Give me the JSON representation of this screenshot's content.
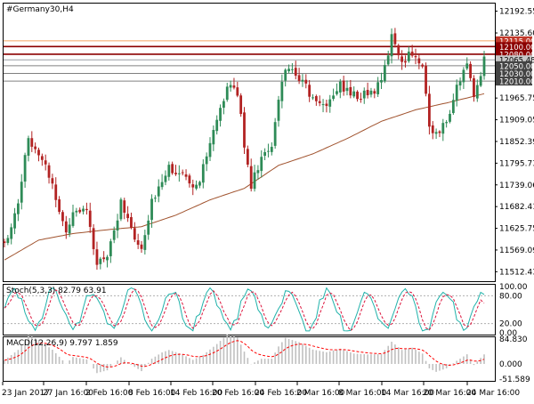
{
  "window_title": "#Germany30,H4",
  "colors": {
    "bull": "#2e8b57",
    "bear": "#b22222",
    "ma": "#a0522d",
    "stoch_main": "#20b2aa",
    "stoch_signal": "#dc143c",
    "macd_hist": "#c0c0c0",
    "macd_signal": "#ff0000",
    "gray_level": "#808080",
    "red_level": "#8b0000",
    "orange_level": "#f4a460"
  },
  "price_ticks": [
    "12192.55",
    "12135.60",
    "11965.75",
    "11909.05",
    "11852.39",
    "11795.73",
    "11739.06",
    "11682.41",
    "11625.75",
    "11569.09",
    "11512.43"
  ],
  "levels": [
    {
      "price": 12115.0,
      "label": "12115.00",
      "style": "orange"
    },
    {
      "price": 12100.0,
      "label": "12100.00",
      "style": "red"
    },
    {
      "price": 12080.0,
      "label": "12080.00",
      "style": "red"
    },
    {
      "price": 12065.48,
      "label": "12065.48",
      "style": "current"
    },
    {
      "price": 12050.0,
      "label": "12050.00",
      "style": "gray"
    },
    {
      "price": 12030.0,
      "label": "12030.00",
      "style": "gray"
    },
    {
      "price": 12010.0,
      "label": "12010.00",
      "style": "gray"
    }
  ],
  "stoch": {
    "label": "Stoch(5,3,3) 82.79 63.91",
    "ticks": [
      "100.00",
      "80.00",
      "20.00",
      "0.00"
    ]
  },
  "macd": {
    "label": "MACD(12,26,9) 9.797 1.859",
    "ticks": [
      "84.830",
      "0.000",
      "-51.589"
    ]
  },
  "time_labels": [
    "23 Jan 2017",
    "27 Jan 16:00",
    "2 Feb 16:00",
    "8 Feb 16:00",
    "14 Feb 16:00",
    "20 Feb 16:00",
    "24 Feb 16:00",
    "2 Mar 16:00",
    "8 Mar 16:00",
    "14 Mar 16:00",
    "20 Mar 16:00",
    "24 Mar 16:00"
  ],
  "chart_data": {
    "type": "candlestick",
    "symbol": "#Germany30",
    "timeframe": "H4",
    "ylim": [
      11490,
      12210
    ],
    "current_price": 12065.48,
    "close_anchors": [
      [
        0,
        11580
      ],
      [
        4,
        11700
      ],
      [
        7,
        11860
      ],
      [
        10,
        11830
      ],
      [
        14,
        11740
      ],
      [
        18,
        11610
      ],
      [
        20,
        11680
      ],
      [
        24,
        11660
      ],
      [
        27,
        11530
      ],
      [
        30,
        11560
      ],
      [
        34,
        11690
      ],
      [
        36,
        11640
      ],
      [
        40,
        11560
      ],
      [
        43,
        11690
      ],
      [
        46,
        11760
      ],
      [
        48,
        11790
      ],
      [
        52,
        11760
      ],
      [
        55,
        11720
      ],
      [
        58,
        11780
      ],
      [
        62,
        11900
      ],
      [
        65,
        12000
      ],
      [
        68,
        11980
      ],
      [
        70,
        11850
      ],
      [
        72,
        11740
      ],
      [
        75,
        11810
      ],
      [
        78,
        11830
      ],
      [
        80,
        11960
      ],
      [
        82,
        12050
      ],
      [
        86,
        12020
      ],
      [
        90,
        11960
      ],
      [
        94,
        11950
      ],
      [
        98,
        12000
      ],
      [
        102,
        11970
      ],
      [
        106,
        11980
      ],
      [
        110,
        12000
      ],
      [
        113,
        12130
      ],
      [
        116,
        12060
      ],
      [
        119,
        12090
      ],
      [
        122,
        12040
      ],
      [
        124,
        11900
      ],
      [
        126,
        11870
      ],
      [
        129,
        11910
      ],
      [
        132,
        11990
      ],
      [
        135,
        12060
      ],
      [
        137,
        11960
      ],
      [
        140,
        12070
      ]
    ],
    "ma_anchors": [
      [
        0,
        11543
      ],
      [
        10,
        11595
      ],
      [
        20,
        11612
      ],
      [
        30,
        11622
      ],
      [
        40,
        11630
      ],
      [
        50,
        11660
      ],
      [
        60,
        11700
      ],
      [
        70,
        11730
      ],
      [
        80,
        11790
      ],
      [
        90,
        11820
      ],
      [
        100,
        11860
      ],
      [
        110,
        11905
      ],
      [
        120,
        11935
      ],
      [
        130,
        11955
      ],
      [
        140,
        11977
      ]
    ]
  }
}
